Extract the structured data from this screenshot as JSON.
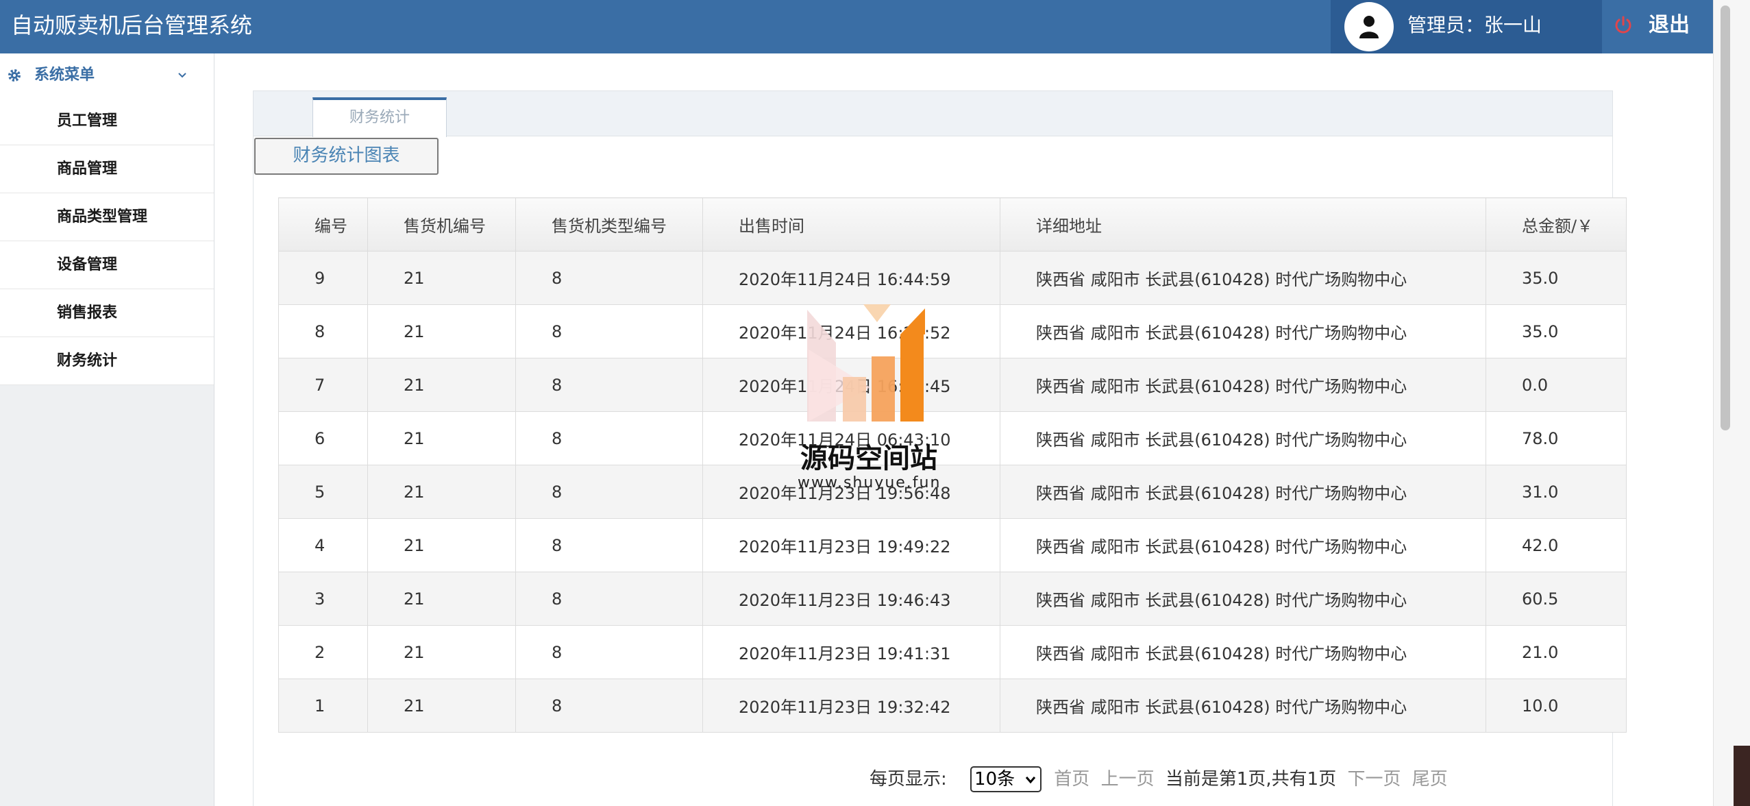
{
  "header": {
    "app_title": "自动贩卖机后台管理系统",
    "user_label": "管理员：张一山",
    "logout_label": "退出",
    "colors": {
      "header_bg": "#3a6ea5",
      "user_bg": "#2c5c93",
      "logout_icon": "#e0454b"
    }
  },
  "sidebar": {
    "menu_title": "系统菜单",
    "items": [
      {
        "label": "员工管理"
      },
      {
        "label": "商品管理"
      },
      {
        "label": "商品类型管理"
      },
      {
        "label": "设备管理"
      },
      {
        "label": "销售报表"
      },
      {
        "label": "财务统计"
      }
    ]
  },
  "main": {
    "tab_label": "财务统计",
    "chart_button_label": "财务统计图表",
    "table": {
      "headers": [
        "编号",
        "售货机编号",
        "售货机类型编号",
        "出售时间",
        "详细地址",
        "总金额/￥"
      ],
      "rows": [
        [
          "9",
          "21",
          "8",
          "2020年11月24日 16:44:59",
          "陕西省 咸阳市 长武县(610428) 时代广场购物中心",
          "35.0"
        ],
        [
          "8",
          "21",
          "8",
          "2020年11月24日 16:21:52",
          "陕西省 咸阳市 长武县(610428) 时代广场购物中心",
          "35.0"
        ],
        [
          "7",
          "21",
          "8",
          "2020年11月24日 16:44:45",
          "陕西省 咸阳市 长武县(610428) 时代广场购物中心",
          "0.0"
        ],
        [
          "6",
          "21",
          "8",
          "2020年11月24日 06:43:10",
          "陕西省 咸阳市 长武县(610428) 时代广场购物中心",
          "78.0"
        ],
        [
          "5",
          "21",
          "8",
          "2020年11月23日 19:56:48",
          "陕西省 咸阳市 长武县(610428) 时代广场购物中心",
          "31.0"
        ],
        [
          "4",
          "21",
          "8",
          "2020年11月23日 19:49:22",
          "陕西省 咸阳市 长武县(610428) 时代广场购物中心",
          "42.0"
        ],
        [
          "3",
          "21",
          "8",
          "2020年11月23日 19:46:43",
          "陕西省 咸阳市 长武县(610428) 时代广场购物中心",
          "60.5"
        ],
        [
          "2",
          "21",
          "8",
          "2020年11月23日 19:41:31",
          "陕西省 咸阳市 长武县(610428) 时代广场购物中心",
          "21.0"
        ],
        [
          "1",
          "21",
          "8",
          "2020年11月23日 19:32:42",
          "陕西省 咸阳市 长武县(610428) 时代广场购物中心",
          "10.0"
        ]
      ]
    },
    "pagination": {
      "per_page_label": "每页显示:",
      "page_size": "10条",
      "first": "首页",
      "prev": "上一页",
      "status": "当前是第1页,共有1页",
      "next": "下一页",
      "last": "尾页"
    }
  },
  "watermark": {
    "text": "源码空间站",
    "url": "www.shuyue.fun"
  },
  "icons": {
    "avatar": "user-icon",
    "logout": "power-icon",
    "menu": "gear-icon",
    "collapse": "chevron-down-icon"
  }
}
